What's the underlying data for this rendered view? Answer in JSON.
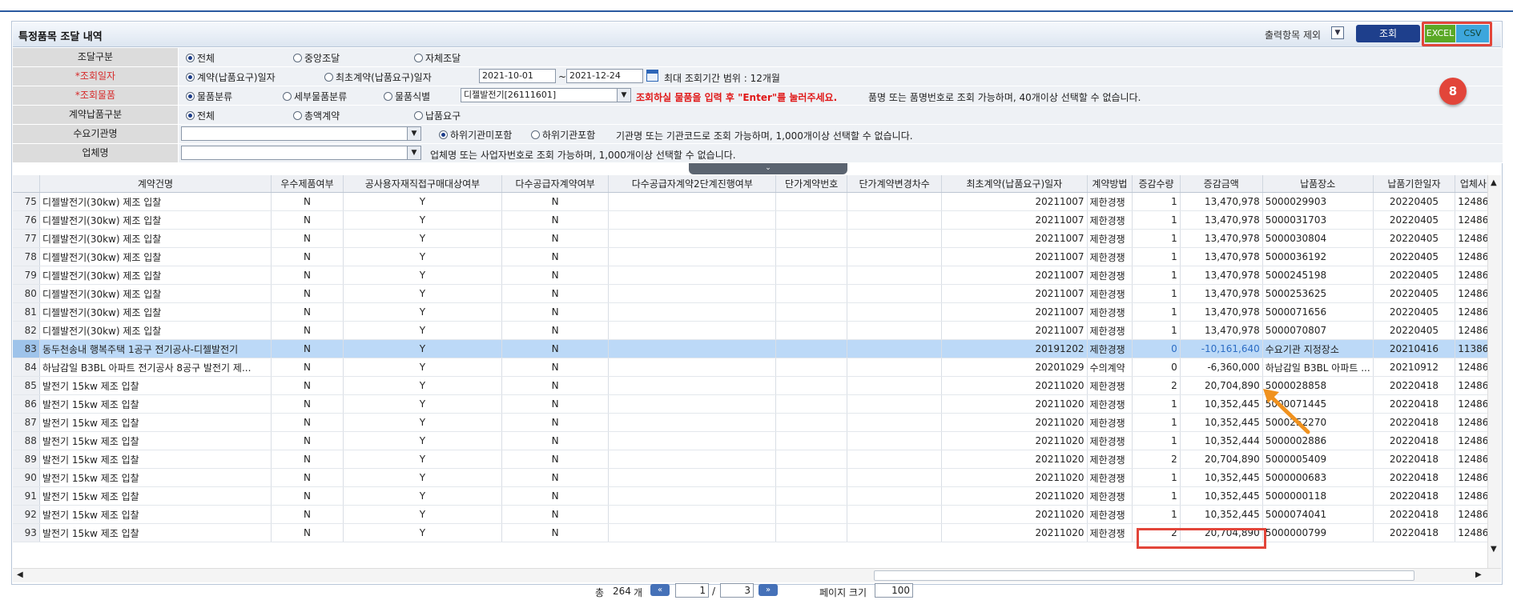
{
  "title": "특정품목 조달 내역",
  "toolbar": {
    "output_exclude_label": "출력항목 제외",
    "search_label": "조회",
    "excel_label": "EXCEL",
    "csv_label": "CSV",
    "badge": "8"
  },
  "form": {
    "procurement_type": {
      "label": "조달구분",
      "options": [
        "전체",
        "중앙조달",
        "자체조달"
      ],
      "selected": "전체"
    },
    "query_date": {
      "label": "*조회일자",
      "options": [
        "계약(납품요구)일자",
        "최초계약(납품요구)일자"
      ],
      "selected": "계약(납품요구)일자",
      "from": "2021-10-01",
      "sep": "~",
      "to": "2021-12-24",
      "note": "최대 조회기간 범위 : 12개월"
    },
    "query_item": {
      "label": "*조회물품",
      "options": [
        "물품분류",
        "세부물품분류",
        "물품식별"
      ],
      "selected": "물품분류",
      "value": "디젤발전기[26111601]",
      "note_red": "조회하실 물품을  입력 후 \"Enter\"를 눌러주세요.",
      "note": "품명 또는 품명번호로 조회 가능하며, 40개이상 선택할 수 없습니다."
    },
    "contract_type": {
      "label": "계약납품구분",
      "options": [
        "전체",
        "총액계약",
        "납품요구"
      ],
      "selected": "전체"
    },
    "demand_agency": {
      "label": "수요기관명",
      "options": [
        "하위기관미포함",
        "하위기관포함"
      ],
      "selected": "하위기관미포함",
      "note": "기관명 또는 기관코드로 조회 가능하며, 1,000개이상 선택할 수 없습니다."
    },
    "company": {
      "label": "업체명",
      "note": "업체명 또는 사업자번호로 조회 가능하며, 1,000개이상 선택할 수 없습니다."
    }
  },
  "table": {
    "columns": [
      "",
      "계약건명",
      "우수제품여부",
      "공사용자재직접구매대상여부",
      "다수공급자계약여부",
      "다수공급자계약2단계진행여부",
      "단가계약번호",
      "단가계약변경차수",
      "최초계약(납품요구)일자",
      "계약방법",
      "증감수량",
      "증감금액",
      "납품장소",
      "납품기한일자",
      "업체사..."
    ],
    "rows": [
      [
        "75",
        "디젤발전기(30kw) 제조 입찰",
        "N",
        "Y",
        "N",
        "",
        "",
        "",
        "20211007",
        "제한경쟁",
        "1",
        "13,470,978",
        "5000029903",
        "20220405",
        "12486..."
      ],
      [
        "76",
        "디젤발전기(30kw) 제조 입찰",
        "N",
        "Y",
        "N",
        "",
        "",
        "",
        "20211007",
        "제한경쟁",
        "1",
        "13,470,978",
        "5000031703",
        "20220405",
        "12486..."
      ],
      [
        "77",
        "디젤발전기(30kw) 제조 입찰",
        "N",
        "Y",
        "N",
        "",
        "",
        "",
        "20211007",
        "제한경쟁",
        "1",
        "13,470,978",
        "5000030804",
        "20220405",
        "12486..."
      ],
      [
        "78",
        "디젤발전기(30kw) 제조 입찰",
        "N",
        "Y",
        "N",
        "",
        "",
        "",
        "20211007",
        "제한경쟁",
        "1",
        "13,470,978",
        "5000036192",
        "20220405",
        "12486..."
      ],
      [
        "79",
        "디젤발전기(30kw) 제조 입찰",
        "N",
        "Y",
        "N",
        "",
        "",
        "",
        "20211007",
        "제한경쟁",
        "1",
        "13,470,978",
        "5000245198",
        "20220405",
        "12486..."
      ],
      [
        "80",
        "디젤발전기(30kw) 제조 입찰",
        "N",
        "Y",
        "N",
        "",
        "",
        "",
        "20211007",
        "제한경쟁",
        "1",
        "13,470,978",
        "5000253625",
        "20220405",
        "12486..."
      ],
      [
        "81",
        "디젤발전기(30kw) 제조 입찰",
        "N",
        "Y",
        "N",
        "",
        "",
        "",
        "20211007",
        "제한경쟁",
        "1",
        "13,470,978",
        "5000071656",
        "20220405",
        "12486..."
      ],
      [
        "82",
        "디젤발전기(30kw) 제조 입찰",
        "N",
        "Y",
        "N",
        "",
        "",
        "",
        "20211007",
        "제한경쟁",
        "1",
        "13,470,978",
        "5000070807",
        "20220405",
        "12486..."
      ],
      [
        "83",
        "동두천송내 행복주택 1공구 전기공사-디젤발전기",
        "N",
        "Y",
        "N",
        "",
        "",
        "",
        "20191202",
        "제한경쟁",
        "0",
        "-10,161,640",
        "수요기관 지정장소",
        "20210416",
        "11386..."
      ],
      [
        "84",
        "하남감일 B3BL 아파트 전기공사 8공구 발전기 제...",
        "N",
        "Y",
        "N",
        "",
        "",
        "",
        "20201029",
        "수의계약",
        "0",
        "-6,360,000",
        "하남감일 B3BL 아파트 ...",
        "20210912",
        "12486..."
      ],
      [
        "85",
        "발전기 15kw 제조 입찰",
        "N",
        "Y",
        "N",
        "",
        "",
        "",
        "20211020",
        "제한경쟁",
        "2",
        "20,704,890",
        "5000028858",
        "20220418",
        "12486..."
      ],
      [
        "86",
        "발전기 15kw 제조 입찰",
        "N",
        "Y",
        "N",
        "",
        "",
        "",
        "20211020",
        "제한경쟁",
        "1",
        "10,352,445",
        "5000071445",
        "20220418",
        "12486..."
      ],
      [
        "87",
        "발전기 15kw 제조 입찰",
        "N",
        "Y",
        "N",
        "",
        "",
        "",
        "20211020",
        "제한경쟁",
        "1",
        "10,352,445",
        "5000252270",
        "20220418",
        "12486..."
      ],
      [
        "88",
        "발전기 15kw 제조 입찰",
        "N",
        "Y",
        "N",
        "",
        "",
        "",
        "20211020",
        "제한경쟁",
        "1",
        "10,352,444",
        "5000002886",
        "20220418",
        "12486..."
      ],
      [
        "89",
        "발전기 15kw 제조 입찰",
        "N",
        "Y",
        "N",
        "",
        "",
        "",
        "20211020",
        "제한경쟁",
        "2",
        "20,704,890",
        "5000005409",
        "20220418",
        "12486..."
      ],
      [
        "90",
        "발전기 15kw 제조 입찰",
        "N",
        "Y",
        "N",
        "",
        "",
        "",
        "20211020",
        "제한경쟁",
        "1",
        "10,352,445",
        "5000000683",
        "20220418",
        "12486..."
      ],
      [
        "91",
        "발전기 15kw 제조 입찰",
        "N",
        "Y",
        "N",
        "",
        "",
        "",
        "20211020",
        "제한경쟁",
        "1",
        "10,352,445",
        "5000000118",
        "20220418",
        "12486..."
      ],
      [
        "92",
        "발전기 15kw 제조 입찰",
        "N",
        "Y",
        "N",
        "",
        "",
        "",
        "20211020",
        "제한경쟁",
        "1",
        "10,352,445",
        "5000074041",
        "20220418",
        "12486..."
      ],
      [
        "93",
        "발전기 15kw 제조 입찰",
        "N",
        "Y",
        "N",
        "",
        "",
        "",
        "20211020",
        "제한경쟁",
        "2",
        "20,704,890",
        "5000000799",
        "20220418",
        "12486..."
      ]
    ],
    "selected_row": "83"
  },
  "pager": {
    "total_prefix": "총",
    "total": "264",
    "total_suffix": "개",
    "page": "1",
    "slash": "/",
    "pages": "3",
    "size_label": "페이지 크기",
    "size": "100"
  },
  "colors": {
    "accent": "#1e3f8c",
    "highlight": "#e2453a",
    "excel": "#5aa825",
    "csv": "#3da6dc",
    "selected_row": "#bcd9f7"
  }
}
